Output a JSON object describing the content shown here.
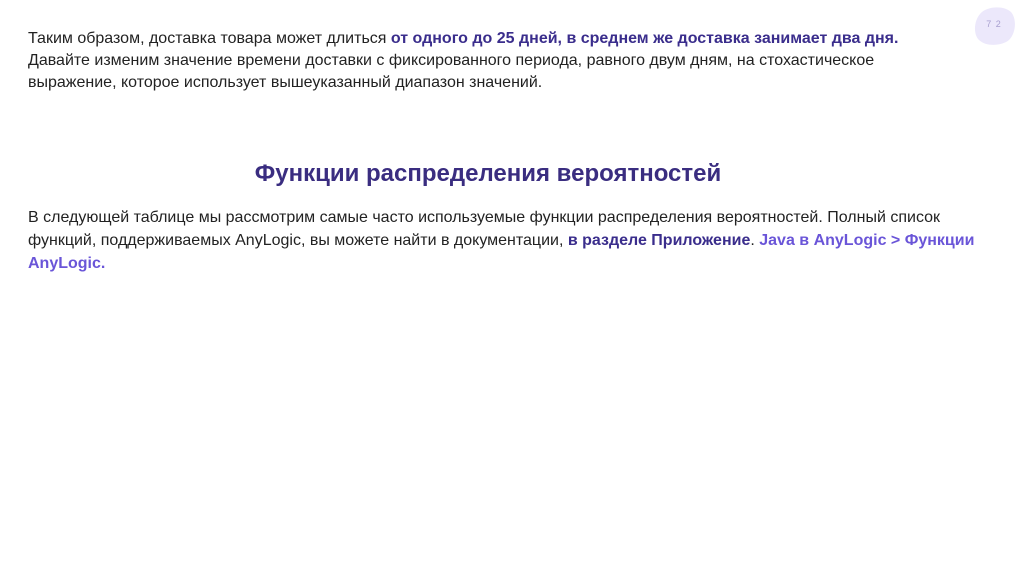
{
  "page": {
    "number": "7 2"
  },
  "intro": {
    "line1_plain": "Таким образом, доставка товара может длиться ",
    "line1_highlight": "от одного до 25 дней, в среднем же доставка занимает два дня.",
    "line2": "Давайте изменим значение времени доставки с фиксированного периода, равного двум дням, на стохастическое выражение, которое использует вышеуказанный диапазон значений."
  },
  "section": {
    "title": "Функции распределения вероятностей"
  },
  "body": {
    "text_plain": "В следующей таблице мы рассмотрим самые часто используемые функции распределения вероятностей. Полный список функций, поддерживаемых AnyLogic, вы можете найти в документации, ",
    "link1": "в разделе Приложение",
    "sep": ". ",
    "link2": "Java в AnyLogic > Функции AnyLogic."
  },
  "colors": {
    "accent_dark": "#3a2d8c",
    "accent_light": "#6a55d8",
    "badge_fill": "#ece8fb"
  }
}
